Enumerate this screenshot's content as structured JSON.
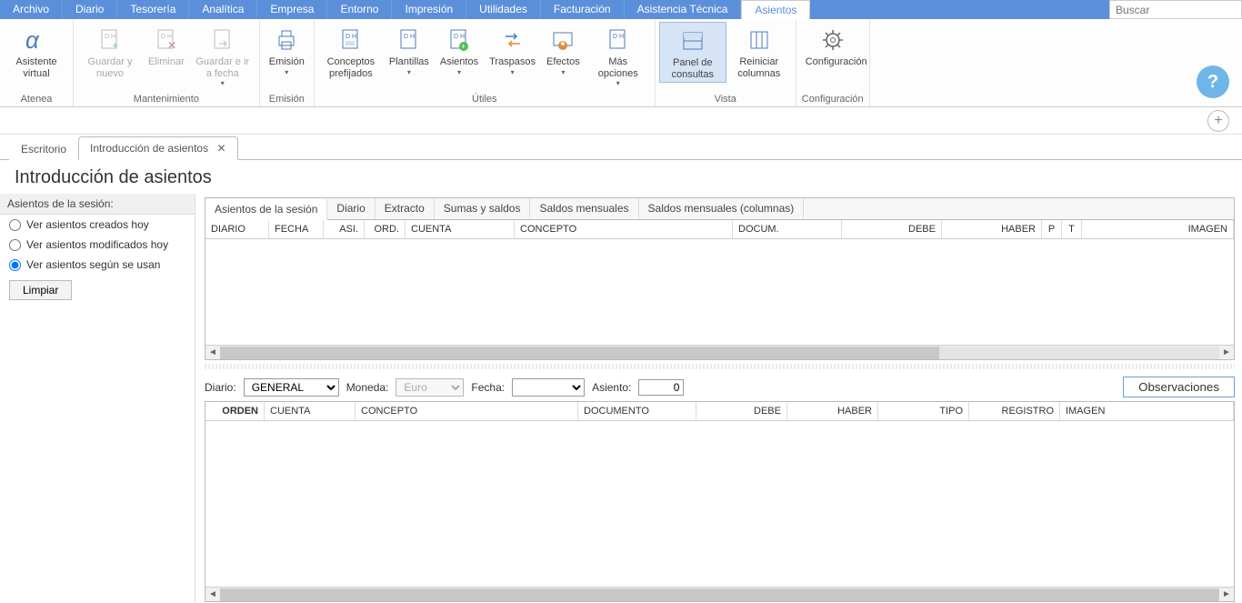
{
  "menu": {
    "items": [
      "Archivo",
      "Diario",
      "Tesorería",
      "Analítica",
      "Empresa",
      "Entorno",
      "Impresión",
      "Utilidades",
      "Facturación",
      "Asistencia Técnica",
      "Asientos"
    ],
    "active_index": 10,
    "search_placeholder": "Buscar"
  },
  "ribbon": {
    "groups": [
      {
        "title": "Atenea",
        "buttons": [
          {
            "name": "asistente-virtual",
            "label": "Asistente virtual",
            "icon": "alpha",
            "interactable": true
          }
        ]
      },
      {
        "title": "Mantenimiento",
        "buttons": [
          {
            "name": "guardar-y-nuevo",
            "label": "Guardar y nuevo",
            "icon": "doc-plus",
            "interactable": false,
            "disabled": true
          },
          {
            "name": "eliminar",
            "label": "Eliminar",
            "icon": "doc-x",
            "interactable": false,
            "disabled": true
          },
          {
            "name": "guardar-e-ir-a-fecha",
            "label": "Guardar e ir a fecha",
            "icon": "doc-arrow",
            "interactable": false,
            "disabled": true,
            "dropdown": true
          }
        ]
      },
      {
        "title": "Emisión",
        "buttons": [
          {
            "name": "emision",
            "label": "Emisión",
            "icon": "printer",
            "interactable": true,
            "dropdown": true
          }
        ]
      },
      {
        "title": "Útiles",
        "buttons": [
          {
            "name": "conceptos-prefijados",
            "label": "Conceptos prefijados",
            "icon": "doc-dh",
            "interactable": true
          },
          {
            "name": "plantillas",
            "label": "Plantillas",
            "icon": "doc-dh",
            "interactable": true,
            "dropdown": true
          },
          {
            "name": "asientos",
            "label": "Asientos",
            "icon": "doc-dh-plus",
            "interactable": true,
            "dropdown": true
          },
          {
            "name": "traspasos",
            "label": "Traspasos",
            "icon": "swap",
            "interactable": true,
            "dropdown": true
          },
          {
            "name": "efectos",
            "label": "Efectos",
            "icon": "person-card",
            "interactable": true,
            "dropdown": true
          },
          {
            "name": "mas-opciones",
            "label": "Más opciones",
            "icon": "doc-dh",
            "interactable": true,
            "dropdown": true
          }
        ]
      },
      {
        "title": "Vista",
        "buttons": [
          {
            "name": "panel-de-consultas",
            "label": "Panel de consultas",
            "icon": "panel",
            "interactable": true,
            "pressed": true
          },
          {
            "name": "reiniciar-columnas",
            "label": "Reiniciar columnas",
            "icon": "columns",
            "interactable": true
          }
        ]
      },
      {
        "title": "Configuración",
        "buttons": [
          {
            "name": "configuracion",
            "label": "Configuración",
            "icon": "gear",
            "interactable": true
          }
        ]
      }
    ]
  },
  "doc_tabs": [
    {
      "label": "Escritorio",
      "active": false,
      "closable": false
    },
    {
      "label": "Introducción de asientos",
      "active": true,
      "closable": true
    }
  ],
  "page_title": "Introducción de asientos",
  "side": {
    "header": "Asientos de la sesión:",
    "radios": [
      {
        "label": "Ver asientos creados hoy",
        "checked": false
      },
      {
        "label": "Ver asientos modificados hoy",
        "checked": false
      },
      {
        "label": "Ver asientos según se usan",
        "checked": true
      }
    ],
    "clear_label": "Limpiar"
  },
  "inner_tabs": [
    "Asientos de la sesión",
    "Diario",
    "Extracto",
    "Sumas y saldos",
    "Saldos mensuales",
    "Saldos mensuales (columnas)"
  ],
  "inner_tabs_active": 0,
  "grid1_headers": [
    "DIARIO",
    "FECHA",
    "ASI.",
    "ORD.",
    "CUENTA",
    "CONCEPTO",
    "DOCUM.",
    "DEBE",
    "HABER",
    "P",
    "T",
    "IMAGEN"
  ],
  "entry": {
    "labels": {
      "diario": "Diario:",
      "moneda": "Moneda:",
      "fecha": "Fecha:",
      "asiento": "Asiento:"
    },
    "diario_value": "GENERAL",
    "moneda_value": "Euro",
    "fecha_value": "",
    "asiento_value": "0",
    "observaciones_label": "Observaciones"
  },
  "grid2_headers": [
    "ORDEN",
    "CUENTA",
    "CONCEPTO",
    "DOCUMENTO",
    "DEBE",
    "HABER",
    "TIPO",
    "REGISTRO",
    "IMAGEN"
  ]
}
